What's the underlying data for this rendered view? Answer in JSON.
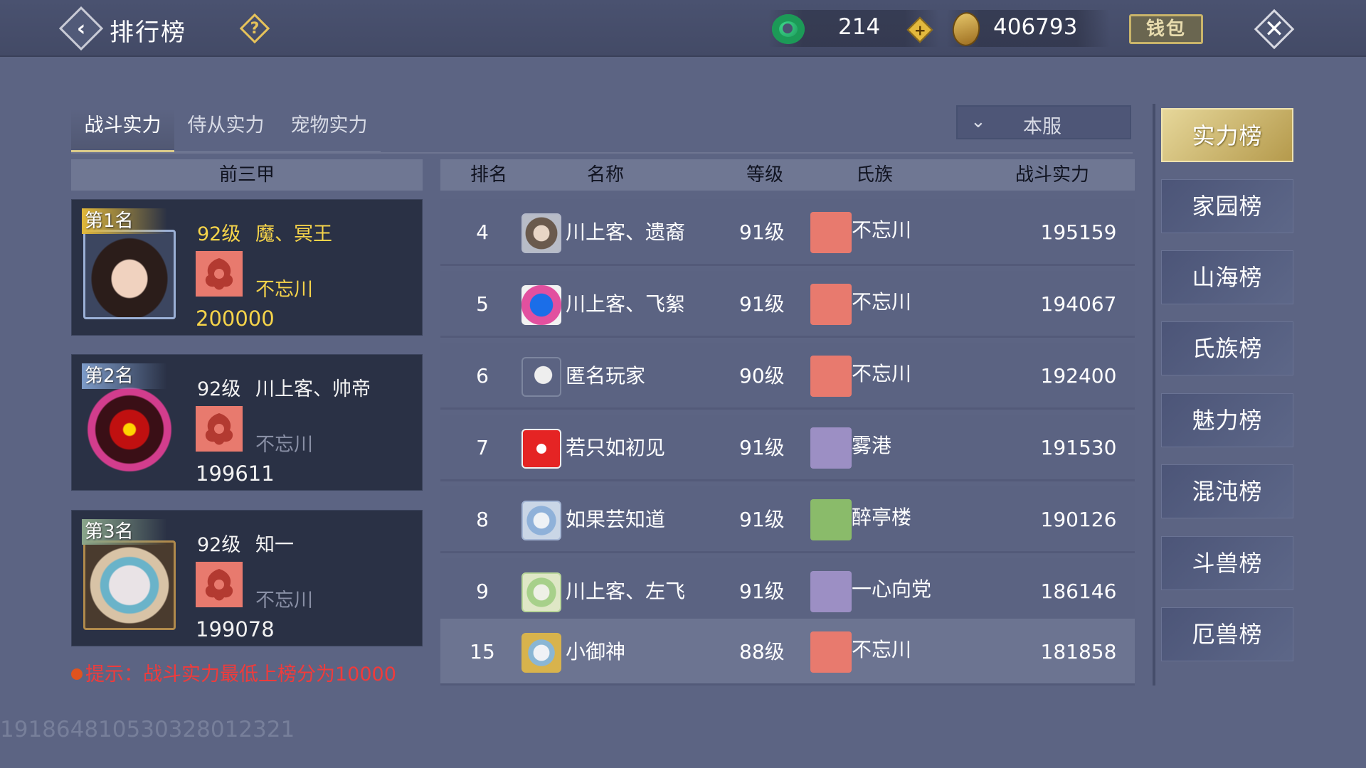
{
  "header": {
    "title": "排行榜",
    "jade_count": "214",
    "coin_count": "406793",
    "wallet_label": "钱包"
  },
  "tabs": [
    {
      "label": "战斗实力",
      "active": true
    },
    {
      "label": "侍从实力",
      "active": false
    },
    {
      "label": "宠物实力",
      "active": false
    }
  ],
  "server_select": {
    "value": "本服"
  },
  "podium": {
    "header": "前三甲",
    "entries": [
      {
        "badge": "第1名",
        "level": "92级",
        "name": "魔、冥王",
        "clan": "不忘川",
        "power": "200000"
      },
      {
        "badge": "第2名",
        "level": "92级",
        "name": "川上客、帅帝",
        "clan": "不忘川",
        "power": "199611"
      },
      {
        "badge": "第3名",
        "level": "92级",
        "name": "知一",
        "clan": "不忘川",
        "power": "199078"
      }
    ]
  },
  "table": {
    "headers": {
      "rank": "排名",
      "name": "名称",
      "level": "等级",
      "clan": "氏族",
      "power": "战斗实力"
    },
    "rows": [
      {
        "rank": "4",
        "name": "川上客、遗裔",
        "level": "91级",
        "clan": "不忘川",
        "power": "195159"
      },
      {
        "rank": "5",
        "name": "川上客、飞絮",
        "level": "91级",
        "clan": "不忘川",
        "power": "194067"
      },
      {
        "rank": "6",
        "name": "匿名玩家",
        "level": "90级",
        "clan": "不忘川",
        "power": "192400"
      },
      {
        "rank": "7",
        "name": "若只如初见",
        "level": "91级",
        "clan": "雾港",
        "power": "191530"
      },
      {
        "rank": "8",
        "name": "如果芸知道",
        "level": "91级",
        "clan": "醉亭楼",
        "power": "190126"
      },
      {
        "rank": "9",
        "name": "川上客、左飞",
        "level": "91级",
        "clan": "一心向党",
        "power": "186146"
      }
    ],
    "self_row": {
      "rank": "15",
      "name": "小御神",
      "level": "88级",
      "clan": "不忘川",
      "power": "181858"
    }
  },
  "hint": "提示：战斗实力最低上榜分为10000",
  "side_nav": [
    {
      "label": "实力榜",
      "active": true
    },
    {
      "label": "家园榜",
      "active": false
    },
    {
      "label": "山海榜",
      "active": false
    },
    {
      "label": "氏族榜",
      "active": false
    },
    {
      "label": "魅力榜",
      "active": false
    },
    {
      "label": "混沌榜",
      "active": false
    },
    {
      "label": "斗兽榜",
      "active": false
    },
    {
      "label": "厄兽榜",
      "active": false
    }
  ],
  "footer": {
    "uid": "1918648105303280123​21"
  },
  "colors": {
    "background": "#5c6483",
    "gold_text": "#f6d44a",
    "hint_red": "#f03b3b",
    "active_nav": "#c9b06a"
  }
}
